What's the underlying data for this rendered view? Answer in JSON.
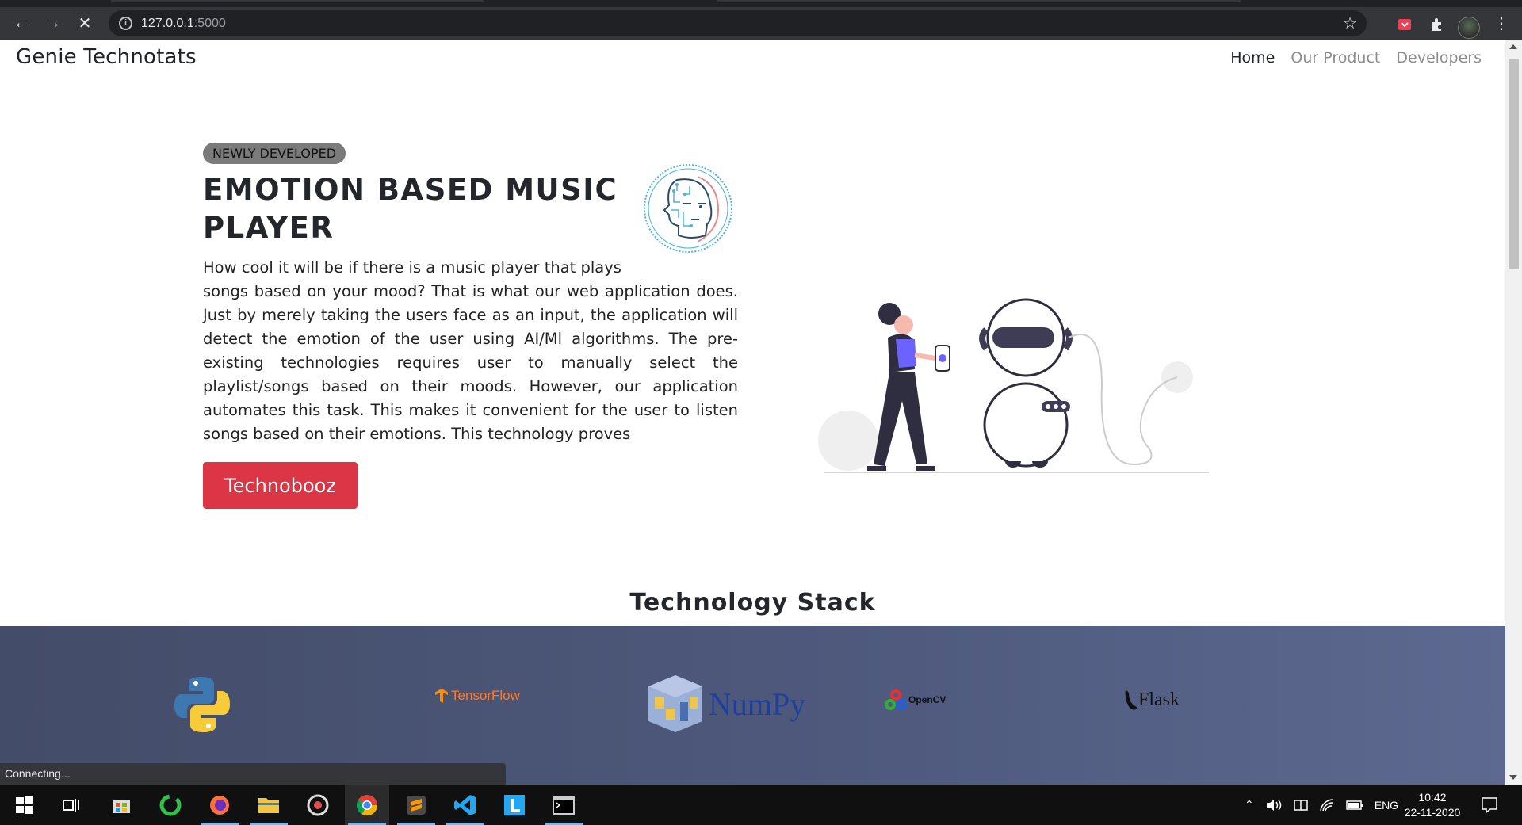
{
  "browser": {
    "url_host": "127.0.0.1",
    "url_port": ":5000",
    "status_text": "Connecting..."
  },
  "navbar": {
    "brand": "Genie Technotats",
    "links": [
      "Home",
      "Our Product",
      "Developers"
    ]
  },
  "hero": {
    "badge": "NEWLY DEVELOPED",
    "title": "EMOTION BASED MUSIC PLAYER",
    "description_first": "How cool it will be if there is a music player that plays",
    "description_rest": "songs based on your mood? That is what our web application does. Just by merely taking the users face as an input, the application will detect the emotion of the user using AI/Ml algorithms. The pre-existing technologies requires user to manually select the playlist/songs based on their moods. However, our application automates this task. This makes it convenient for the user to listen songs based on their emotions. This technology proves",
    "button_label": "Technobooz"
  },
  "stack": {
    "heading": "Technology Stack",
    "logos": [
      "TensorFlow",
      "NumPy",
      "OpenCV",
      "Flask"
    ]
  },
  "taskbar": {
    "language": "ENG",
    "time": "10:42",
    "date": "22-11-2020"
  },
  "colors": {
    "accent_red": "#dc3545",
    "band": "#4f5a7e",
    "chrome": "#35363a"
  }
}
